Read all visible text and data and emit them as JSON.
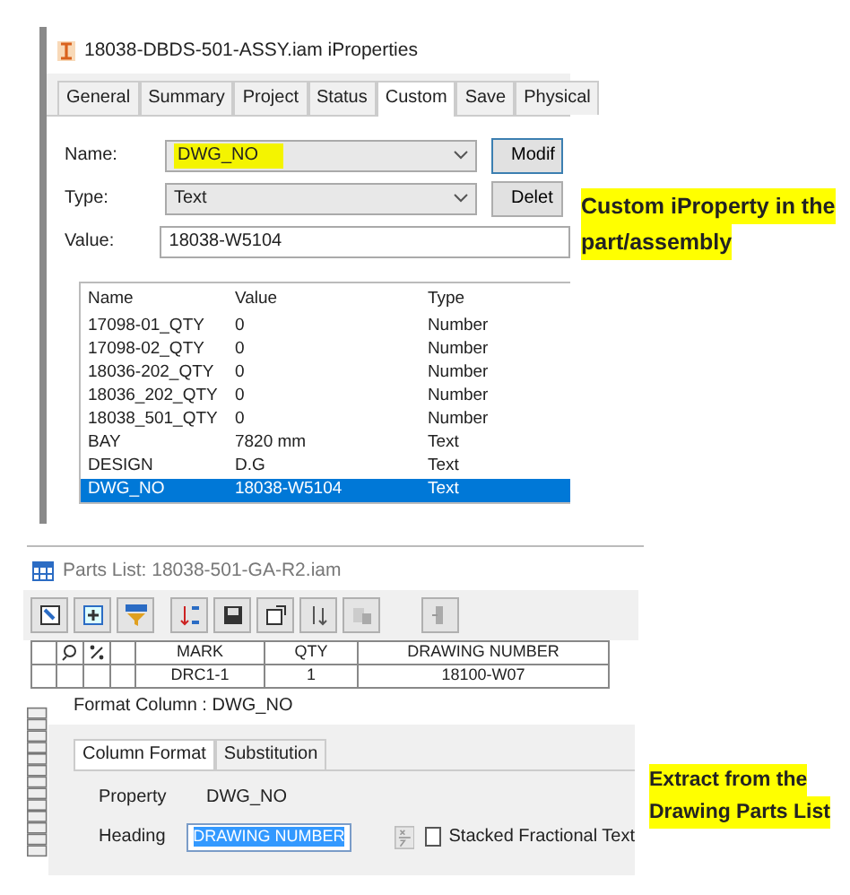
{
  "iproperties": {
    "title": "18038-DBDS-501-ASSY.iam iProperties",
    "tabs": [
      {
        "label": "General",
        "selected": false,
        "highlighted": false
      },
      {
        "label": "Summary",
        "selected": false,
        "highlighted": false
      },
      {
        "label": "Project",
        "selected": false,
        "highlighted": false
      },
      {
        "label": "Status",
        "selected": false,
        "highlighted": false
      },
      {
        "label": "Custom",
        "selected": true,
        "highlighted": true
      },
      {
        "label": "Save",
        "selected": false,
        "highlighted": false
      },
      {
        "label": "Physical",
        "selected": false,
        "highlighted": false
      }
    ],
    "fields": [
      {
        "label": "Name:",
        "value": "DWG_NO",
        "kind": "dropdown",
        "highlighted": true,
        "button": "Modif"
      },
      {
        "label": "Type:",
        "value": "Text",
        "kind": "dropdown",
        "button": "Delet"
      },
      {
        "label": "Value:",
        "value": "18038-W5104",
        "kind": "text"
      }
    ],
    "list": {
      "columns": [
        "Name",
        "Value",
        "Type"
      ],
      "rows": [
        {
          "cells": [
            "17098-01_QTY",
            "0",
            "Number"
          ],
          "selected": false
        },
        {
          "cells": [
            "17098-02_QTY",
            "0",
            "Number"
          ],
          "selected": false
        },
        {
          "cells": [
            "18036-202_QTY",
            "0",
            "Number"
          ],
          "selected": false
        },
        {
          "cells": [
            "18036_202_QTY",
            "0",
            "Number"
          ],
          "selected": false
        },
        {
          "cells": [
            "18038_501_QTY",
            "0",
            "Number"
          ],
          "selected": false
        },
        {
          "cells": [
            "BAY",
            "7820 mm",
            "Text"
          ],
          "selected": false
        },
        {
          "cells": [
            "DESIGN",
            "D.G",
            "Text"
          ],
          "selected": false
        },
        {
          "cells": [
            "DWG_NO",
            "18038-W5104",
            "Text"
          ],
          "selected": true
        }
      ]
    }
  },
  "annotations": [
    {
      "text": "Custom iProperty in the part/assembly"
    },
    {
      "text": "Extract from the Drawing Parts List"
    }
  ],
  "parts_list": {
    "title": "Parts List: 18038-501-GA-R2.iam",
    "columns": [
      "MARK",
      "QTY",
      "DRAWING NUMBER"
    ],
    "rows": [
      [
        "DRC1-1",
        "1",
        "18100-W07"
      ]
    ]
  },
  "format_column": {
    "title": "Format Column : DWG_NO",
    "tabs": [
      {
        "label": "Column Format",
        "selected": true
      },
      {
        "label": "Substitution",
        "selected": false
      }
    ],
    "property_label": "Property",
    "property_value": "DWG_NO",
    "heading_label": "Heading",
    "heading_value": "DRAWING NUMBER",
    "stacked": {
      "label": "Stacked Fractional Text",
      "checked": false
    }
  }
}
